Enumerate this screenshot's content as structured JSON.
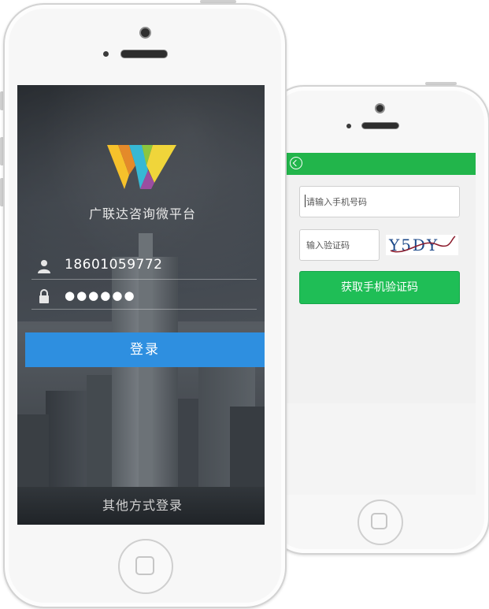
{
  "front_screen": {
    "app_title": "广联达咨询微平台",
    "username": "18601059772",
    "password_mask": "●●●●●●",
    "login_label": "登录",
    "other_login_label": "其他方式登录"
  },
  "back_screen": {
    "phone_placeholder": "请输入手机号码",
    "code_placeholder": "输入验证码",
    "captcha_text": "Y5DY",
    "get_code_label": "获取手机验证码"
  },
  "colors": {
    "login_button": "#2e8fe0",
    "header_bar": "#22b54b",
    "get_code_button": "#1fbe56"
  },
  "icons": [
    "user-icon",
    "lock-icon",
    "back-arrow-icon",
    "app-logo"
  ]
}
